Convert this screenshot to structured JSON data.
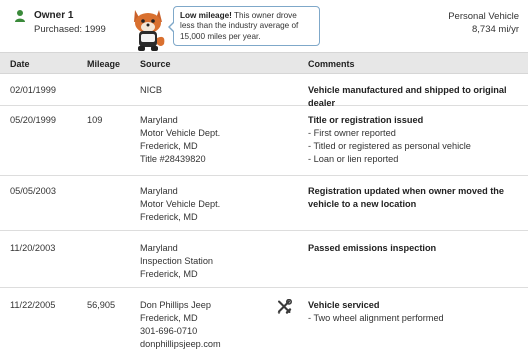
{
  "owner": {
    "title": "Owner 1",
    "purchased": "Purchased: 1999",
    "vehicle_type": "Personal Vehicle",
    "mileage_rate": "8,734 mi/yr"
  },
  "callout": {
    "bold": "Low mileage!",
    "text": " This owner drove less than the industry average of 15,000 miles per year."
  },
  "table": {
    "headers": {
      "date": "Date",
      "mileage": "Mileage",
      "source": "Source",
      "comments": "Comments"
    },
    "rows": [
      {
        "date": "02/01/1999",
        "mileage": "",
        "source": [
          "NICB"
        ],
        "comment_head": "Vehicle manufactured and shipped to original dealer",
        "comment_items": []
      },
      {
        "date": "05/20/1999",
        "mileage": "109",
        "source": [
          "Maryland",
          "Motor Vehicle Dept.",
          "Frederick, MD",
          "Title #28439820"
        ],
        "comment_head": "Title or registration issued",
        "comment_items": [
          "- First owner reported",
          "- Titled or registered as personal vehicle",
          "- Loan or lien reported"
        ]
      },
      {
        "date": "05/05/2003",
        "mileage": "",
        "source": [
          "Maryland",
          "Motor Vehicle Dept.",
          "Frederick, MD"
        ],
        "comment_head": "Registration updated when owner moved the vehicle to a new location",
        "comment_items": []
      },
      {
        "date": "11/20/2003",
        "mileage": "",
        "source": [
          "Maryland",
          "Inspection Station",
          "Frederick, MD"
        ],
        "comment_head": "Passed emissions inspection",
        "comment_items": []
      },
      {
        "date": "11/22/2005",
        "mileage": "56,905",
        "source": [
          "Don Phillips Jeep",
          "Frederick, MD",
          "301-696-0710",
          "donphillipsjeep.com"
        ],
        "comment_head": "Vehicle serviced",
        "comment_items": [
          "- Two wheel alignment performed"
        ],
        "icon": "wrench-screwdriver-icon"
      }
    ]
  },
  "colors": {
    "owner_icon": "#3a8a3a",
    "header_bg": "#e7e7e7",
    "callout_border": "#7fa8c9"
  }
}
